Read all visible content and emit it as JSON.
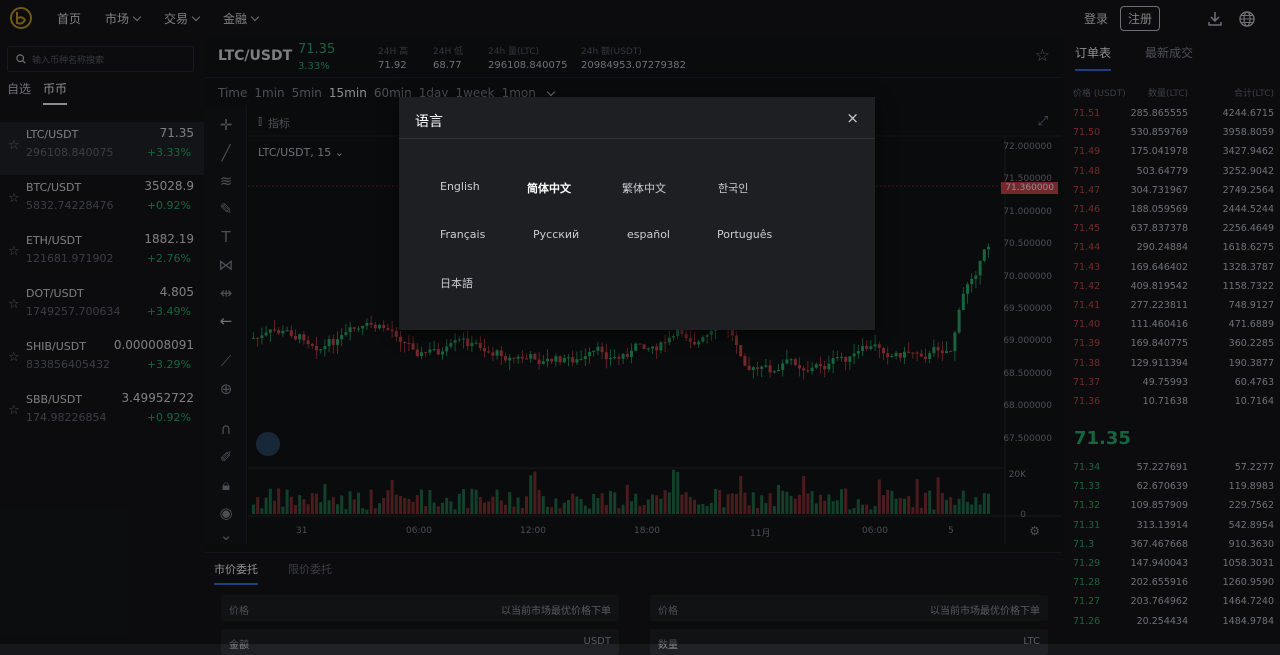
{
  "nav": {
    "items": [
      {
        "label": "首页",
        "dropdown": false
      },
      {
        "label": "市场",
        "dropdown": true
      },
      {
        "label": "交易",
        "dropdown": true
      },
      {
        "label": "金融",
        "dropdown": true
      }
    ],
    "login": "登录",
    "register": "注册",
    "icons": [
      "download-icon",
      "globe-icon"
    ]
  },
  "sidebar": {
    "search_placeholder": "输入币种名称搜索",
    "tabs": [
      "自选",
      "币币"
    ],
    "active_tab": 1,
    "pairs": [
      {
        "name": "LTC/USDT",
        "volume": "296108.840075",
        "price": "71.35",
        "change": "+3.33%"
      },
      {
        "name": "BTC/USDT",
        "volume": "5832.74228476",
        "price": "35028.9",
        "change": "+0.92%"
      },
      {
        "name": "ETH/USDT",
        "volume": "121681.971902",
        "price": "1882.19",
        "change": "+2.76%"
      },
      {
        "name": "DOT/USDT",
        "volume": "1749257.700634",
        "price": "4.805",
        "change": "+3.49%"
      },
      {
        "name": "SHIB/USDT",
        "volume": "833856405432",
        "price": "0.000008091",
        "change": "+3.29%"
      },
      {
        "name": "SBB/USDT",
        "volume": "174.98226854",
        "price": "3.49952722",
        "change": "+0.92%"
      }
    ]
  },
  "ticker": {
    "symbol": "LTC/USDT",
    "price": "71.35",
    "change": "3.33%",
    "stats": [
      {
        "label": "24H 高",
        "value": "71.92"
      },
      {
        "label": "24H 低",
        "value": "68.77"
      },
      {
        "label": "24h 量(LTC)",
        "value": "296108.840075"
      },
      {
        "label": "24h 额(USDT)",
        "value": "20984953.07279382"
      }
    ]
  },
  "intervals": {
    "items": [
      "Time",
      "1min",
      "5min",
      "15min",
      "60min",
      "1day",
      "1week",
      "1mon"
    ],
    "active": "15min"
  },
  "chart": {
    "symbol_label": "LTC/USDT, 15",
    "indicator_label": "指标",
    "current_price": "71.360000",
    "price_levels": [
      "72.000000",
      "71.500000",
      "71.000000",
      "70.500000",
      "70.000000",
      "69.500000",
      "69.000000",
      "68.500000",
      "68.000000",
      "67.500000"
    ],
    "volume_levels": [
      "20K",
      "0"
    ],
    "time_labels": [
      "31",
      "06:00",
      "12:00",
      "18:00",
      "11月",
      "06:00",
      "5"
    ],
    "colors": {
      "up": "#2bb673",
      "down": "#d8474f"
    }
  },
  "orderbook": {
    "tabs": [
      "订单表",
      "最新成交"
    ],
    "headers": [
      "价格 (USDT)",
      "数量(LTC)",
      "合计(LTC)"
    ],
    "asks": [
      [
        "71.51",
        "285.865555",
        "4244.6715"
      ],
      [
        "71.50",
        "530.859769",
        "3958.8059"
      ],
      [
        "71.49",
        "175.041978",
        "3427.9462"
      ],
      [
        "71.48",
        "503.64779",
        "3252.9042"
      ],
      [
        "71.47",
        "304.731967",
        "2749.2564"
      ],
      [
        "71.46",
        "188.059569",
        "2444.5244"
      ],
      [
        "71.45",
        "637.837378",
        "2256.4649"
      ],
      [
        "71.44",
        "290.24884",
        "1618.6275"
      ],
      [
        "71.43",
        "169.646402",
        "1328.3787"
      ],
      [
        "71.42",
        "409.819542",
        "1158.7322"
      ],
      [
        "71.41",
        "277.223811",
        "748.9127"
      ],
      [
        "71.40",
        "111.460416",
        "471.6889"
      ],
      [
        "71.39",
        "169.840775",
        "360.2285"
      ],
      [
        "71.38",
        "129.911394",
        "190.3877"
      ],
      [
        "71.37",
        "49.75993",
        "60.4763"
      ],
      [
        "71.36",
        "10.71638",
        "10.7164"
      ]
    ],
    "mid_price": "71.35",
    "bids": [
      [
        "71.34",
        "57.227691",
        "57.2277"
      ],
      [
        "71.33",
        "62.670639",
        "119.8983"
      ],
      [
        "71.32",
        "109.857909",
        "229.7562"
      ],
      [
        "71.31",
        "313.13914",
        "542.8954"
      ],
      [
        "71.3",
        "367.467668",
        "910.3630"
      ],
      [
        "71.29",
        "147.940043",
        "1058.3031"
      ],
      [
        "71.28",
        "202.655916",
        "1260.9590"
      ],
      [
        "71.27",
        "203.764962",
        "1464.7240"
      ],
      [
        "71.26",
        "20.254434",
        "1484.9784"
      ]
    ]
  },
  "orders": {
    "tabs": [
      "市价委托",
      "限价委托"
    ],
    "buy": {
      "price_label": "价格",
      "price_hint": "以当前市场最优价格下单",
      "amount_label": "金额",
      "amount_unit": "USDT"
    },
    "sell": {
      "price_label": "价格",
      "price_hint": "以当前市场最优价格下单",
      "amount_label": "数量",
      "amount_unit": "LTC"
    }
  },
  "language_modal": {
    "title": "语言",
    "close": "×",
    "languages": [
      "English",
      "简体中文",
      "繁体中文",
      "한국인",
      "Français",
      "Русский",
      "español",
      "Português",
      "日本語"
    ],
    "active": "简体中文"
  }
}
